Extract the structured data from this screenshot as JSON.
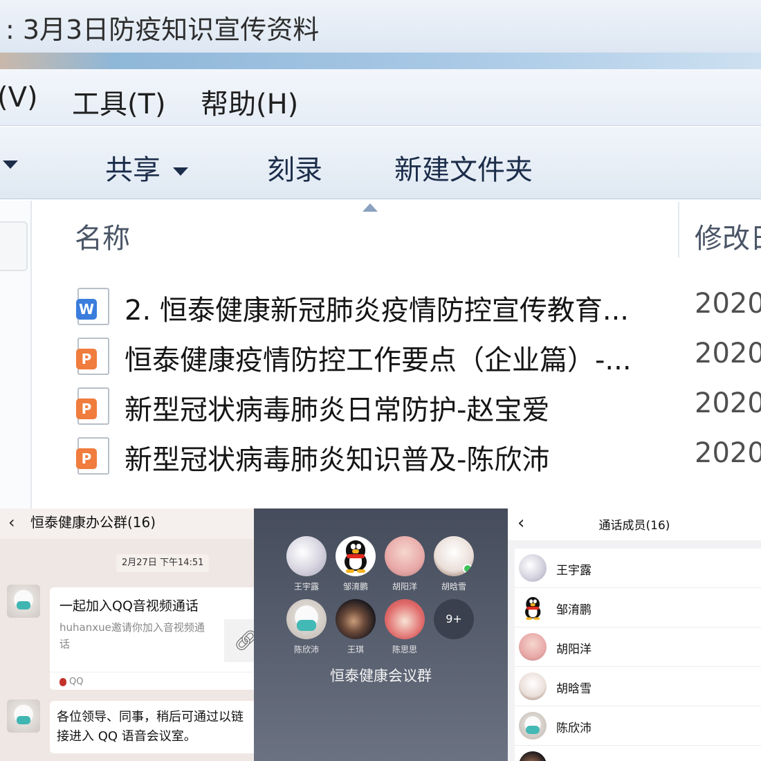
{
  "explorer": {
    "title": ": 3月3日防疫知识宣传资料",
    "menu": [
      "(V)",
      "工具(T)",
      "帮助(H)"
    ],
    "toolbar": {
      "share": "共享",
      "burn": "刻录",
      "new_folder": "新建文件夹"
    },
    "columns": {
      "name": "名称",
      "modified": "修改日"
    },
    "files": [
      {
        "type": "word",
        "badge": "W",
        "name": "2. 恒泰健康新冠肺炎疫情防控宣传教育...",
        "date": "2020"
      },
      {
        "type": "ppt",
        "badge": "P",
        "name": "恒泰健康疫情防控工作要点（企业篇）-...",
        "date": "2020"
      },
      {
        "type": "ppt",
        "badge": "P",
        "name": "新型冠状病毒肺炎日常防护-赵宝爱",
        "date": "2020"
      },
      {
        "type": "ppt",
        "badge": "P",
        "name": "新型冠状病毒肺炎知识普及-陈欣沛",
        "date": "2020"
      }
    ]
  },
  "chat": {
    "title": "恒泰健康办公群(16)",
    "time": "2月27日 下午14:51",
    "card": {
      "title": "一起加入QQ音视频通话",
      "desc": "huhanxue邀请你加入音视频通话",
      "source": "QQ"
    },
    "message": "各位领导、同事，稍后可通过以链接进入 QQ 语音会议室。"
  },
  "call": {
    "members": [
      "王宇露",
      "邹淯鹏",
      "胡阳洋",
      "胡晗雪",
      "陈欣沛",
      "王琪",
      "陈思思"
    ],
    "more": "9+",
    "group_name": "恒泰健康会议群"
  },
  "members_panel": {
    "title": "通话成员(16)",
    "members": [
      "王宇露",
      "邹淯鹏",
      "胡阳洋",
      "胡晗雪",
      "陈欣沛"
    ]
  }
}
